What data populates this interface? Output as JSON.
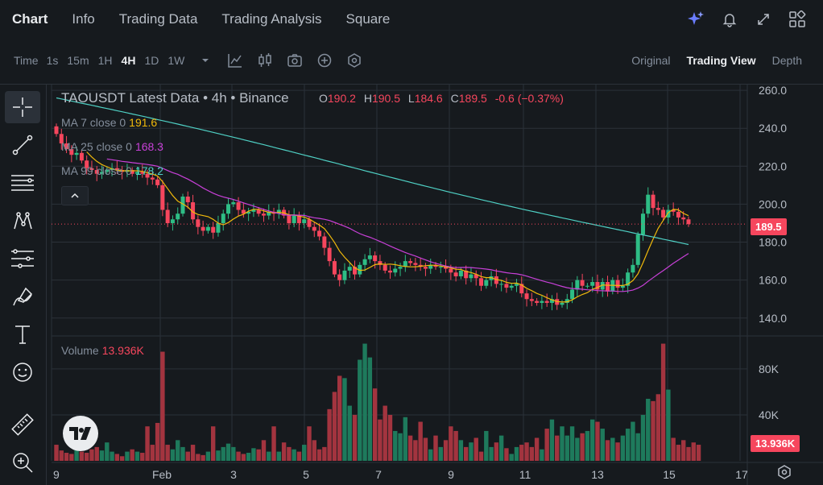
{
  "tabs": [
    "Chart",
    "Info",
    "Trading Data",
    "Trading Analysis",
    "Square"
  ],
  "active_tab": "Chart",
  "top_icons": [
    "ai-sparkle-icon",
    "bell-icon",
    "fullscreen-icon",
    "layout-grid-icon"
  ],
  "toolbar": {
    "time_label": "Time",
    "intervals": [
      "1s",
      "15m",
      "1H",
      "4H",
      "1D",
      "1W"
    ],
    "active_interval": "4H",
    "icons": [
      "dropdown-caret-icon",
      "indicators-icon",
      "candle-type-icon",
      "screenshot-icon",
      "add-icon",
      "settings-hex-icon"
    ],
    "views": [
      "Original",
      "Trading View",
      "Depth"
    ],
    "active_view": "Trading View"
  },
  "left_tools": [
    "crosshair-icon",
    "trendline-icon",
    "horizontal-lines-icon",
    "pattern-icon",
    "fib-icon",
    "brush-icon",
    "text-icon",
    "emoji-icon",
    "ruler-icon",
    "zoom-in-icon"
  ],
  "legend": {
    "pair": "TAOUSDT Latest Data",
    "sep1": "•",
    "interval": "4h",
    "sep2": "•",
    "exchange": "Binance",
    "o_label": "O",
    "o": "190.2",
    "h_label": "H",
    "h": "190.5",
    "l_label": "L",
    "l": "184.6",
    "c_label": "C",
    "c": "189.5",
    "change": "-0.6 (−0.37%)",
    "ma7_label": "MA 7 close 0",
    "ma7": "191.6",
    "ma25_label": "MA 25 close 0",
    "ma25": "168.3",
    "ma99_label": "MA 99 close 0",
    "ma99": "178.2",
    "volume_label": "Volume",
    "volume": "13.936K",
    "price_badge": "189.5",
    "volume_badge": "13.936K"
  },
  "colors": {
    "up": "#2ebd85",
    "down": "#f6465d",
    "ma7": "#f0b90b",
    "ma25": "#c840d8",
    "ma99": "#4fd1c5",
    "grid": "#2b3139",
    "bg": "#161a1e"
  },
  "chart_data": {
    "type": "candlestick",
    "price_axis": {
      "ticks": [
        "260.0",
        "240.0",
        "220.0",
        "200.0",
        "180.0",
        "160.0",
        "140.0"
      ],
      "range": [
        131,
        263
      ]
    },
    "volume_axis": {
      "ticks": [
        "80K",
        "40K"
      ],
      "range": [
        0,
        108000
      ]
    },
    "x_ticks": [
      "9",
      "Feb",
      "3",
      "5",
      "7",
      "9",
      "11",
      "13",
      "15",
      "17"
    ],
    "last_price": 189.5,
    "closes": [
      237,
      232,
      229,
      226,
      227,
      223,
      219,
      218,
      216,
      217,
      218,
      219,
      218,
      217,
      218,
      216,
      217,
      216,
      214,
      213,
      210,
      197,
      190,
      192,
      195,
      204,
      201,
      192,
      188,
      186,
      188,
      185,
      190,
      195,
      200,
      201,
      197,
      195,
      196,
      197,
      195,
      194,
      196,
      195,
      197,
      194,
      190,
      194,
      190,
      192,
      188,
      186,
      183,
      177,
      170,
      163,
      160,
      165,
      167,
      163,
      168,
      171,
      173,
      170,
      168,
      165,
      164,
      166,
      167,
      170,
      169,
      168,
      167,
      166,
      168,
      167,
      167,
      166,
      164,
      162,
      165,
      161,
      163,
      161,
      157,
      160,
      162,
      158,
      158,
      156,
      157,
      158,
      153,
      150,
      149,
      148,
      149,
      148,
      150,
      147,
      148,
      150,
      155,
      160,
      157,
      157,
      159,
      155,
      159,
      154,
      160,
      156,
      157,
      164,
      168,
      184,
      195,
      205,
      198,
      197,
      193,
      197,
      196,
      193,
      192,
      189.5
    ],
    "volumes": [
      14000,
      9000,
      7000,
      6000,
      11000,
      8000,
      7000,
      10000,
      12000,
      9000,
      16000,
      8000,
      6000,
      4000,
      8000,
      10000,
      8000,
      7000,
      30000,
      14000,
      33000,
      95000,
      14000,
      10000,
      18000,
      12000,
      8000,
      14000,
      6000,
      5000,
      8000,
      30000,
      9000,
      12000,
      15000,
      12000,
      8000,
      6000,
      7000,
      11000,
      10000,
      18000,
      8000,
      30000,
      8000,
      16000,
      12000,
      10000,
      8000,
      14000,
      30000,
      18000,
      10000,
      12000,
      45000,
      60000,
      74000,
      72000,
      48000,
      40000,
      88000,
      102000,
      90000,
      63000,
      36000,
      48000,
      40000,
      26000,
      24000,
      38000,
      22000,
      18000,
      34000,
      20000,
      10000,
      22000,
      12000,
      18000,
      30000,
      26000,
      18000,
      12000,
      16000,
      20000,
      8000,
      26000,
      12000,
      16000,
      22000,
      11000,
      6000,
      12000,
      14000,
      16000,
      12000,
      20000,
      10000,
      28000,
      36000,
      22000,
      30000,
      22000,
      30000,
      20000,
      24000,
      26000,
      36000,
      34000,
      28000,
      18000,
      20000,
      16000,
      22000,
      28000,
      34000,
      24000,
      40000,
      54000,
      52000,
      58000,
      102000,
      62000,
      20000,
      14000,
      18000,
      12000,
      16000,
      14000
    ],
    "ma99_endpoints": [
      [
        0,
        256
      ],
      [
        125,
        178
      ]
    ]
  }
}
